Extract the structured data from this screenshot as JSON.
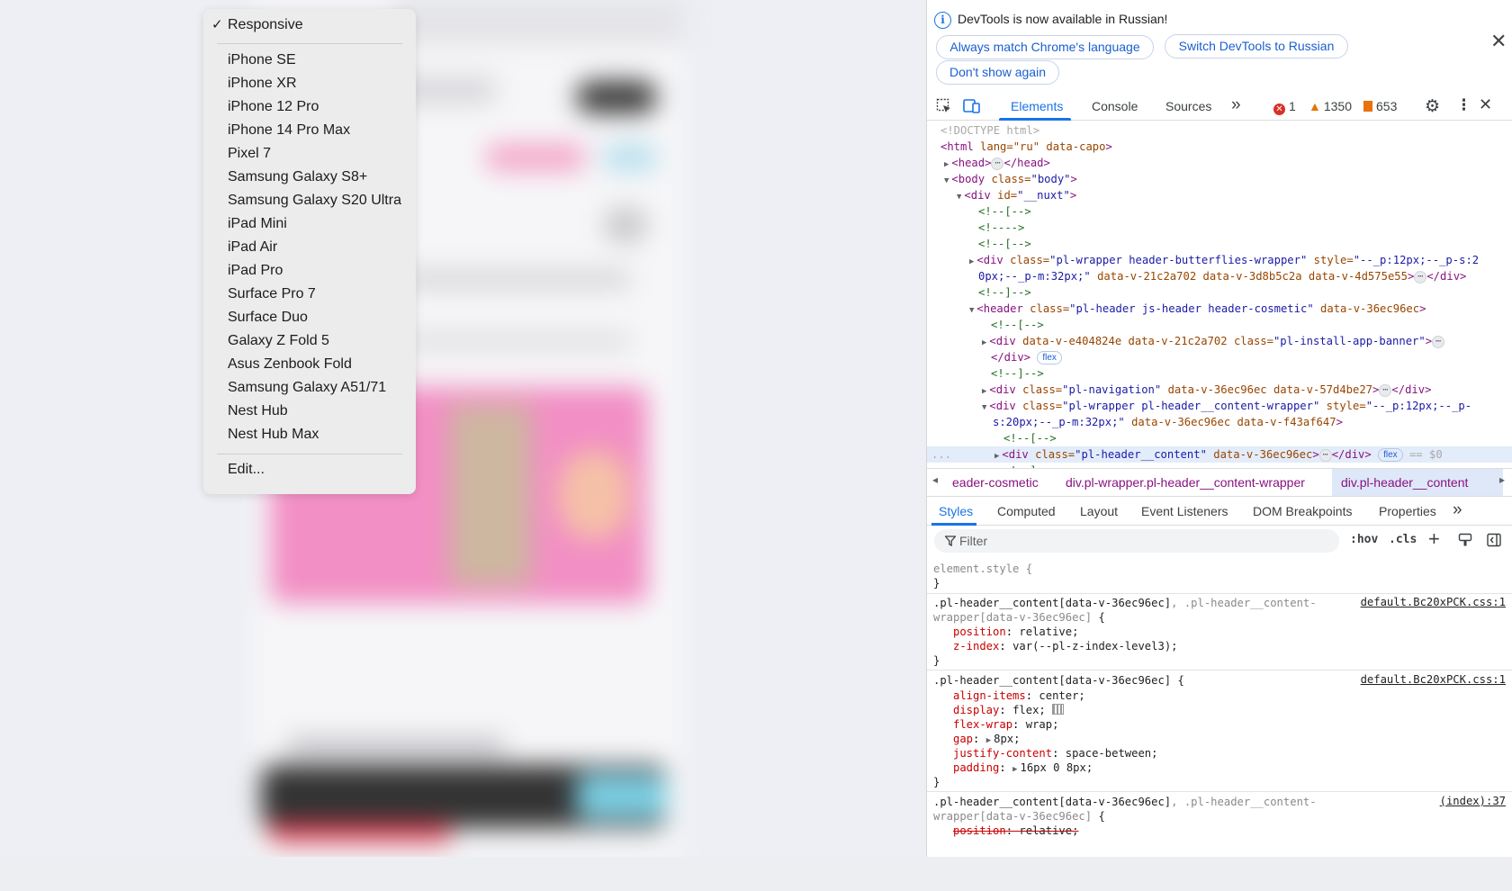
{
  "device_menu": {
    "selected": "Responsive",
    "devices": [
      "iPhone SE",
      "iPhone XR",
      "iPhone 12 Pro",
      "iPhone 14 Pro Max",
      "Pixel 7",
      "Samsung Galaxy S8+",
      "Samsung Galaxy S20 Ultra",
      "iPad Mini",
      "iPad Air",
      "iPad Pro",
      "Surface Pro 7",
      "Surface Duo",
      "Galaxy Z Fold 5",
      "Asus Zenbook Fold",
      "Samsung Galaxy A51/71",
      "Nest Hub",
      "Nest Hub Max"
    ],
    "edit_label": "Edit..."
  },
  "infobar": {
    "message": "DevTools is now available in Russian!",
    "buttons": [
      "Always match Chrome's language",
      "Switch DevTools to Russian",
      "Don't show again"
    ]
  },
  "toolbar": {
    "tabs": [
      "Elements",
      "Console",
      "Sources"
    ],
    "active_tab": "Elements",
    "more": "»",
    "errors": "1",
    "warnings": "1350",
    "issues": "653"
  },
  "dom": {
    "doctype": "<!DOCTYPE html>",
    "html_open": "<html",
    "html_lang": "lang=\"ru\"",
    "html_capo": "data-capo",
    "html_end": ">",
    "head_line_open": "<head>",
    "head_line_close": "</head>",
    "body_tag": "<body",
    "body_attr": "class=",
    "body_val": "\"body\"",
    "nuxt_tag": "<div",
    "nuxt_attr": "id=",
    "nuxt_val": "\"__nuxt\"",
    "c1": "<!--[-->",
    "c2": "<!---->",
    "c3": "<!--[-->",
    "wrap_tag": "<div",
    "wrap_class": "class=",
    "wrap_class_val": "\"pl-wrapper header-butterflies-wrapper\"",
    "wrap_style": "style=",
    "wrap_style_val": "\"--_p:12px;--_p-s:2",
    "wrap_cont": "0px;--_p-m:32px;\"",
    "wrap_cont_attrs": "data-v-21c2a702 data-v-3d8b5c2a data-v-4d575e55",
    "wrap_close": "</div>",
    "c4": "<!--]-->",
    "header_tag": "<header",
    "header_class": "class=",
    "header_class_val": "\"pl-header js-header header-cosmetic\"",
    "header_attr": "data-v-36ec96ec",
    "c5": "<!--[-->",
    "banner_tag": "<div",
    "banner_attrs": "data-v-e404824e data-v-21c2a702",
    "banner_class": "class=",
    "banner_class_val": "\"pl-install-app-banner\"",
    "banner_close": "</div>",
    "flex_chip": "flex",
    "c6": "<!--]-->",
    "nav_tag": "<div",
    "nav_class": "class=",
    "nav_class_val": "\"pl-navigation\"",
    "nav_attrs": "data-v-36ec96ec data-v-57d4be27",
    "nav_close": "</div>",
    "cw_tag": "<div",
    "cw_class": "class=",
    "cw_class_val": "\"pl-wrapper pl-header__content-wrapper\"",
    "cw_style": "style=",
    "cw_style_val": "\"--_p:12px;--_p-",
    "cw_cont": "s:20px;--_p-m:32px;\"",
    "cw_cont_attrs": "data-v-36ec96ec data-v-f43af647",
    "c7": "<!--[-->",
    "sel_tag": "<div",
    "sel_class": "class=",
    "sel_class_val": "\"pl-header__content\"",
    "sel_attr": "data-v-36ec96ec",
    "sel_close": "</div>",
    "sel_eq": "== $0",
    "c8": "<!--]-->",
    "row_dots": "..."
  },
  "breadcrumbs": [
    "eader-cosmetic",
    "div.pl-wrapper.pl-header__content-wrapper",
    "div.pl-header__content"
  ],
  "subtabs": [
    "Styles",
    "Computed",
    "Layout",
    "Event Listeners",
    "DOM Breakpoints",
    "Properties"
  ],
  "filter": {
    "placeholder": "Filter",
    "hov": ":hov",
    "cls": ".cls"
  },
  "styles": {
    "element_style": "element.style {",
    "close": "}",
    "r1_sel": ".pl-header__content[data-v-36ec96ec]",
    "r1_sel2": ", .pl-header__content-",
    "r1_sel3": "wrapper[data-v-36ec96ec]",
    "r1_open": " {",
    "r1_src": "default.Bc20xPCK.css:1",
    "r1_p1": "position",
    "r1_v1": "relative;",
    "r1_p2": "z-index",
    "r1_v2": "var(--pl-z-index-level3);",
    "r2_sel": ".pl-header__content[data-v-36ec96ec] {",
    "r2_src": "default.Bc20xPCK.css:1",
    "r2_p1": "align-items",
    "r2_v1": "center;",
    "r2_p2": "display",
    "r2_v2": "flex;",
    "r2_p3": "flex-wrap",
    "r2_v3": "wrap;",
    "r2_p4": "gap",
    "r2_v4": "8px;",
    "r2_p5": "justify-content",
    "r2_v5": "space-between;",
    "r2_p6": "padding",
    "r2_v6": "16px 0 8px;",
    "r3_sel": ".pl-header__content[data-v-36ec96ec]",
    "r3_sel2": ", .pl-header__content-",
    "r3_sel3": "wrapper[data-v-36ec96ec]",
    "r3_open": " {",
    "r3_src": "(index):37",
    "r3_p1": "position",
    "r3_v1": "relative;"
  }
}
